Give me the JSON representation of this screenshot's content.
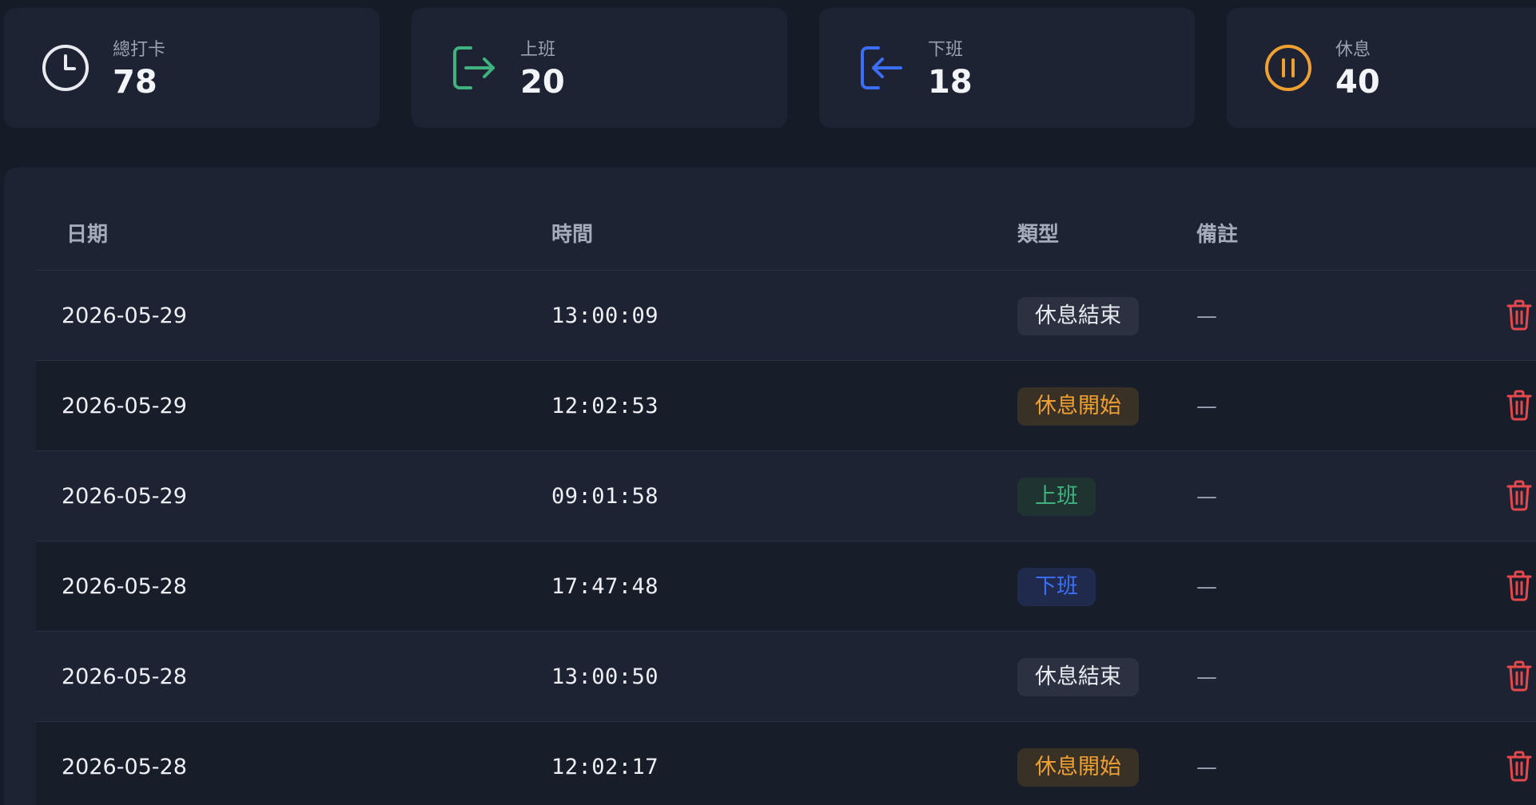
{
  "stats": [
    {
      "label": "總打卡",
      "value": "78",
      "icon": "clock-icon",
      "color": "#e8eaf0"
    },
    {
      "label": "上班",
      "value": "20",
      "icon": "clock-in-icon",
      "color": "#3fb27f"
    },
    {
      "label": "下班",
      "value": "18",
      "icon": "clock-out-icon",
      "color": "#3b6ef5"
    },
    {
      "label": "休息",
      "value": "40",
      "icon": "pause-icon",
      "color": "#f0a030"
    }
  ],
  "table": {
    "headers": {
      "date": "日期",
      "time": "時間",
      "type": "類型",
      "note": "備註"
    },
    "rows": [
      {
        "date": "2026-05-29",
        "time": "13:00:09",
        "type": "休息結束",
        "type_kind": "break_end",
        "note": "—"
      },
      {
        "date": "2026-05-29",
        "time": "12:02:53",
        "type": "休息開始",
        "type_kind": "break_start",
        "note": "—"
      },
      {
        "date": "2026-05-29",
        "time": "09:01:58",
        "type": "上班",
        "type_kind": "clock_in",
        "note": "—"
      },
      {
        "date": "2026-05-28",
        "time": "17:47:48",
        "type": "下班",
        "type_kind": "clock_out",
        "note": "—"
      },
      {
        "date": "2026-05-28",
        "time": "13:00:50",
        "type": "休息結束",
        "type_kind": "break_end",
        "note": "—"
      },
      {
        "date": "2026-05-28",
        "time": "12:02:17",
        "type": "休息開始",
        "type_kind": "break_start",
        "note": "—"
      }
    ]
  },
  "badge_colors": {
    "break_end": {
      "fg": "#e8eaf0",
      "bg": "#2b3140"
    },
    "break_start": {
      "fg": "#f0a030",
      "bg": "#3a3126"
    },
    "clock_in": {
      "fg": "#3fb27f",
      "bg": "#1f3330"
    },
    "clock_out": {
      "fg": "#3b6ef5",
      "bg": "#1f2a4d"
    }
  },
  "delete_icon": "trash-icon",
  "delete_color": "#e5484d"
}
